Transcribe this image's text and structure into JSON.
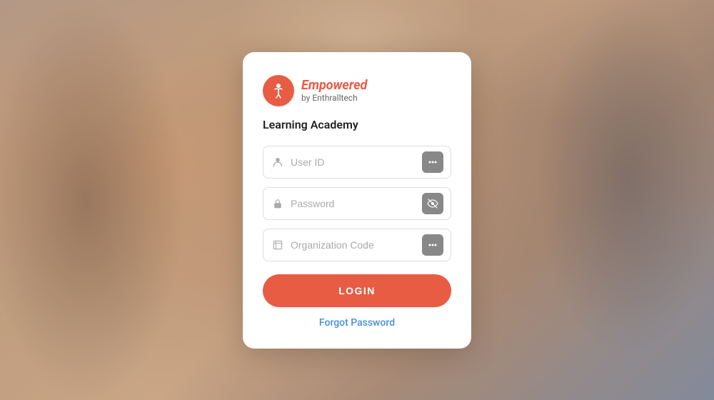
{
  "background": {
    "alt": "people collaborating background"
  },
  "logo": {
    "brand": "Empowered",
    "sub": "by Enthralltech",
    "accent_color": "#e85c44"
  },
  "card": {
    "title": "Learning Academy",
    "userid_placeholder": "User ID",
    "password_placeholder": "Password",
    "org_code_placeholder": "Organization Code",
    "login_button": "LOGIN",
    "forgot_password_link": "Forgot Password"
  }
}
